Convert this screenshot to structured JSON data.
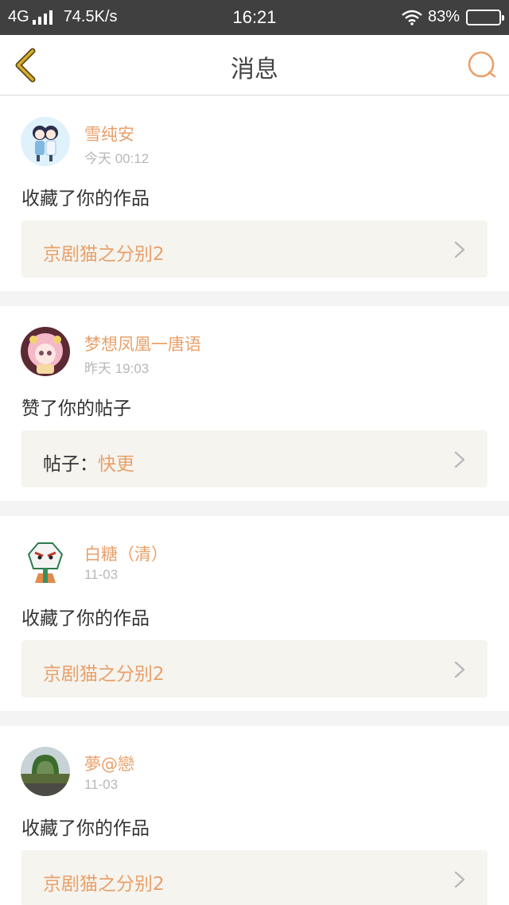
{
  "status_bar": {
    "network": "4G",
    "speed": "74.5K/s",
    "time": "16:21",
    "battery": "83%",
    "battery_level": 0.83
  },
  "nav": {
    "title": "消息",
    "back_icon": "chevron-left-icon",
    "search_icon": "search-icon"
  },
  "colors": {
    "accent": "#e9a06a",
    "back_icon": "#c9a020",
    "ref_bg": "#f5f4ef"
  },
  "messages": [
    {
      "username": "雪纯安",
      "time": "今天 00:12",
      "action": "收藏了你的作品",
      "ref_prefix": "",
      "ref_title": "京剧猫之分别2"
    },
    {
      "username": "梦想凤凰一唐语",
      "time": "昨天 19:03",
      "action": "赞了你的帖子",
      "ref_prefix": "帖子：",
      "ref_title": "快更"
    },
    {
      "username": "白糖（清）",
      "time": "11-03",
      "action": "收藏了你的作品",
      "ref_prefix": "",
      "ref_title": "京剧猫之分别2"
    },
    {
      "username": "夢@戀",
      "time": "11-03",
      "action": "收藏了你的作品",
      "ref_prefix": "",
      "ref_title": "京剧猫之分别2"
    }
  ]
}
